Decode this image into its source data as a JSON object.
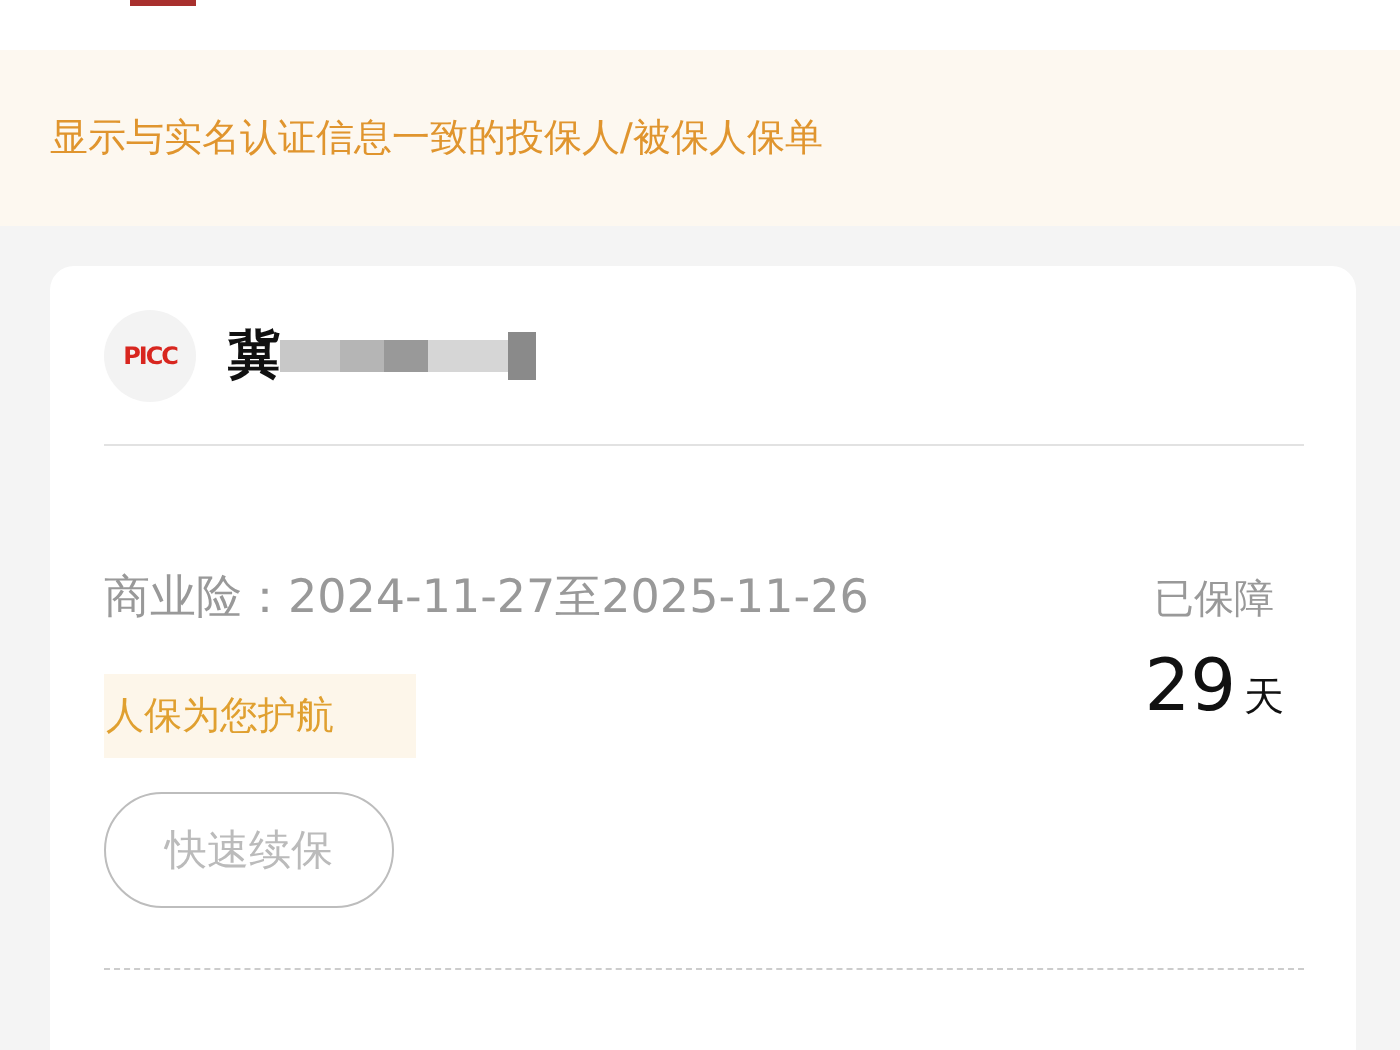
{
  "notice": {
    "text": "显示与实名认证信息一致的投保人/被保人保单"
  },
  "policy_card": {
    "logo": "PICC",
    "holder_name": "冀",
    "coverage": {
      "label": "商业险：2024-11-27至2025-11-26",
      "tag": "人保为您护航",
      "renew_button": {
        "label": "快速续保",
        "disabled": true
      }
    },
    "protected": {
      "label": "已保障",
      "days": "29",
      "unit": "天"
    }
  }
}
